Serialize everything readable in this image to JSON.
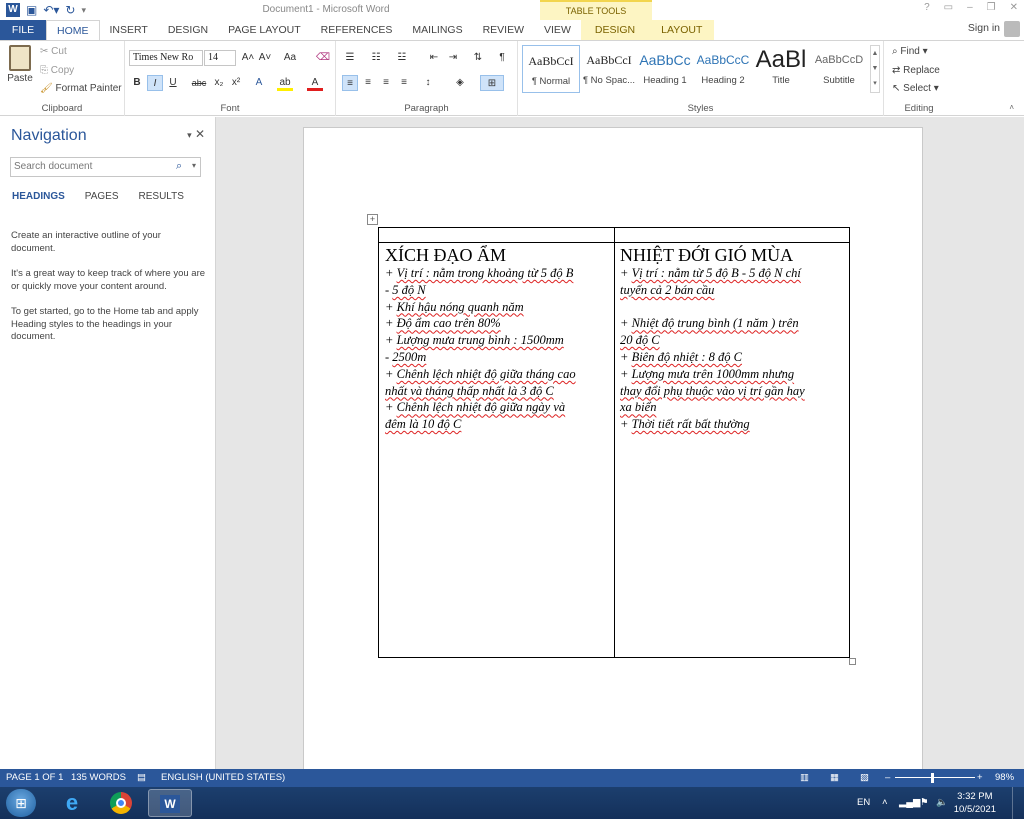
{
  "window": {
    "title": "Document1 - Microsoft Word",
    "contextual_tab_group": "TABLE TOOLS",
    "help": "?",
    "sign_in": "Sign in"
  },
  "ribbon_tabs": [
    "FILE",
    "HOME",
    "INSERT",
    "DESIGN",
    "PAGE LAYOUT",
    "REFERENCES",
    "MAILINGS",
    "REVIEW",
    "VIEW",
    "DESIGN",
    "LAYOUT"
  ],
  "active_tab": "HOME",
  "clipboard": {
    "paste": "Paste",
    "cut": "Cut",
    "copy": "Copy",
    "format_painter": "Format Painter",
    "label": "Clipboard"
  },
  "font": {
    "family": "Times New Ro",
    "size": "14",
    "grow": "A˄",
    "shrink": "A˅",
    "change_case": "Aa",
    "bold": "B",
    "italic": "I",
    "underline": "U",
    "strikethrough": "abc",
    "subscript": "x₂",
    "superscript": "x²",
    "label": "Font"
  },
  "paragraph": {
    "label": "Paragraph"
  },
  "styles": {
    "items": [
      {
        "sample": "AaBbCcI",
        "name": "¶ Normal"
      },
      {
        "sample": "AaBbCcI",
        "name": "¶ No Spac..."
      },
      {
        "sample": "AaBbCc",
        "name": "Heading 1"
      },
      {
        "sample": "AaBbCcC",
        "name": "Heading 2"
      },
      {
        "sample": "AaBl",
        "name": "Title"
      },
      {
        "sample": "AaBbCcD",
        "name": "Subtitle"
      }
    ],
    "label": "Styles"
  },
  "editing": {
    "find": "Find",
    "replace": "Replace",
    "select": "Select",
    "label": "Editing"
  },
  "navigation": {
    "title": "Navigation",
    "search_placeholder": "Search document",
    "tabs": [
      "HEADINGS",
      "PAGES",
      "RESULTS"
    ],
    "active_tab": "HEADINGS",
    "help_paragraphs": [
      "Create an interactive outline of your document.",
      "It's a great way to keep track of where you are or quickly move your content around.",
      "To get started, go to the Home tab and apply Heading styles to the headings in your document."
    ]
  },
  "document": {
    "table": {
      "left": {
        "title": "XÍCH ĐẠO ẨM",
        "lines": [
          "+ Vị trí : nằm trong khoảng từ 5 độ B",
          "- 5 độ N",
          "+ Khí hậu nóng quanh năm",
          "+ Độ ẩm cao trên 80%",
          "+ Lượng mưa trung bình : 1500mm",
          "- 2500m",
          "+ Chênh lệch nhiệt độ giữa tháng cao",
          "nhất và tháng thấp nhất là 3 độ C",
          "+ Chênh lệch nhiệt độ giữa ngày và",
          "đêm là 10 độ C"
        ]
      },
      "right": {
        "title": "NHIỆT ĐỚI GIÓ MÙA",
        "lines": [
          "+ Vị trí : nằm từ 5 độ B - 5 độ N chí",
          "tuyến cả 2 bán cầu",
          "",
          "+ Nhiệt độ trung bình (1 năm ) trên",
          "20 độ C",
          "+ Biên độ nhiệt : 8 độ C",
          "+ Lượng mưa trên 1000mm nhưng",
          "thay đổi phụ thuộc vào vị trí gần hay",
          "xa biển",
          "+ Thời tiết rất bất thường"
        ]
      }
    }
  },
  "statusbar": {
    "page": "PAGE 1 OF 1",
    "words": "135 WORDS",
    "language": "ENGLISH (UNITED STATES)",
    "zoom": "98%"
  },
  "taskbar": {
    "language": "EN",
    "time": "3:32 PM",
    "date": "10/5/2021"
  },
  "colors": {
    "accent": "#2b579a",
    "table_tools": "#fdf5c3"
  }
}
